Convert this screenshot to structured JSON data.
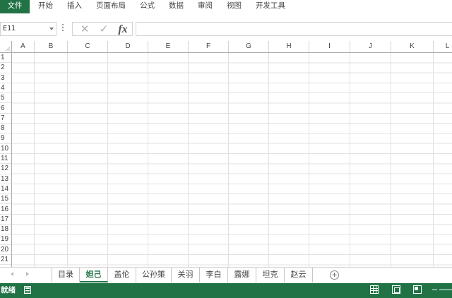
{
  "ribbon": {
    "tabs": [
      "文件",
      "开始",
      "插入",
      "页面布局",
      "公式",
      "数据",
      "审阅",
      "视图",
      "开发工具"
    ]
  },
  "formula_bar": {
    "name_box": "E11",
    "fx_label": "fx",
    "value": ""
  },
  "grid": {
    "columns": [
      "A",
      "B",
      "C",
      "D",
      "E",
      "F",
      "G",
      "H",
      "I",
      "J",
      "K",
      "L"
    ],
    "rows": [
      "1",
      "2",
      "3",
      "4",
      "5",
      "6",
      "7",
      "8",
      "9",
      "10",
      "11",
      "12",
      "13",
      "14",
      "15",
      "16",
      "17",
      "18",
      "19",
      "20",
      "21"
    ]
  },
  "sheets": {
    "tabs": [
      "目录",
      "妲己",
      "盖伦",
      "公孙策",
      "关羽",
      "李白",
      "露娜",
      "坦克",
      "赵云"
    ],
    "active_index": 1
  },
  "status": {
    "ready_text": "就绪"
  },
  "colors": {
    "accent": "#217346",
    "gridline": "#e1e1e1"
  }
}
